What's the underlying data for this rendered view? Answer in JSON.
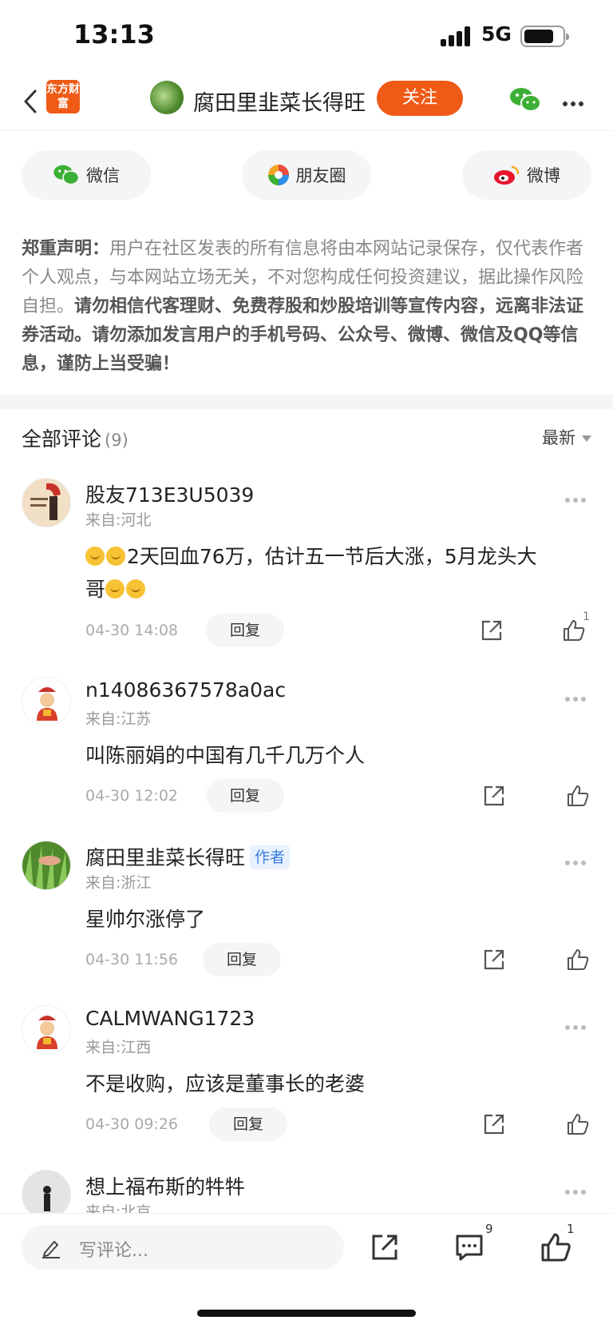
{
  "status_bar": {
    "time": "13:13",
    "network": "5G"
  },
  "nav": {
    "app_logo": "东方财富",
    "title": "腐田里韭菜长得旺",
    "follow_label": "关注"
  },
  "share": {
    "wechat": "微信",
    "moments": "朋友圈",
    "weibo": "微博"
  },
  "disclaimer": {
    "label": "郑重声明：",
    "normal": "用户在社区发表的所有信息将由本网站记录保存，仅代表作者个人观点，与本网站立场无关，不对您构成任何投资建议，据此操作风险自担。",
    "bold": "请勿相信代客理财、免费荐股和炒股培训等宣传内容，远离非法证券活动。请勿添加发言用户的手机号码、公众号、微博、微信及QQ等信息，谨防上当受骗！"
  },
  "comments_section": {
    "title": "全部评论",
    "count": "(9)",
    "sort": "最新"
  },
  "comments": [
    {
      "user": "股友713E3U5039",
      "location": "来自:河北",
      "text_a": "2天回血76万，估计五一节后大涨，5月龙头大",
      "text_b": "哥",
      "time": "04-30 14:08",
      "reply": "回复",
      "likes": "1"
    },
    {
      "user": "n14086367578a0ac",
      "location": "来自:江苏",
      "text": "叫陈丽娟的中国有几千几万个人",
      "time": "04-30 12:02",
      "reply": "回复"
    },
    {
      "user": "腐田里韭菜长得旺",
      "author_tag": "作者",
      "location": "来自:浙江",
      "text": "星帅尔涨停了",
      "time": "04-30 11:56",
      "reply": "回复"
    },
    {
      "user": "CALMWANG1723",
      "location": "来自:江西",
      "text": "不是收购，应该是董事长的老婆",
      "time": "04-30 09:26",
      "reply": "回复"
    },
    {
      "user": "想上福布斯的牪牪",
      "location": "来自:北京"
    }
  ],
  "bottom_bar": {
    "placeholder": "写评论...",
    "comment_count": "9",
    "like_count": "1"
  },
  "colors": {
    "accent": "#ef5a16",
    "author_tag": "#3b7fe0"
  },
  "icons": [
    "back-icon",
    "wechat-icon",
    "more-icon",
    "moments-icon",
    "weibo-icon",
    "share-icon",
    "like-icon",
    "pencil-icon",
    "comment-icon"
  ]
}
